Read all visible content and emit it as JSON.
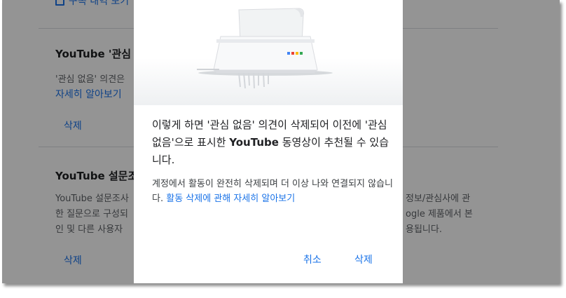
{
  "background": {
    "top_link": "구독 내역 보기",
    "section1": {
      "title": "YouTube '관심 없",
      "desc_start": "'관심 없음' 의견은",
      "learn_more": "자세히 알아보기",
      "delete": "삭제"
    },
    "section2": {
      "title": "YouTube 설문조",
      "line1_left": "YouTube 설문조사",
      "line1_right": "정보/관심사에 관",
      "line2_left": "한 질문으로 구성되",
      "line2_right": "ogle 제품에서 본",
      "line3_left": "인 및 다른 사용자",
      "line3_right": "용됩니다.",
      "delete": "삭제"
    }
  },
  "dialog": {
    "message1_a": "이렇게 하면 '관심 없음' 의견이 삭제되어 이전에 '관심 없음'으로 표시한 ",
    "message1_brand": "YouTube",
    "message1_b": " 동영상이 추천될 수 있습니다.",
    "message2_text": "계정에서 활동이 완전히 삭제되며 더 이상 나와 연결되지 않습니다. ",
    "message2_link": "활동 삭제에 관해 자세히 알아보기",
    "cancel_label": "취소",
    "delete_label": "삭제"
  },
  "colors": {
    "accent": "#1a73e8",
    "scrim": "rgba(0,0,0,0.42)",
    "logo_dots": [
      "#4285f4",
      "#ea4335",
      "#fbbc04",
      "#34a853"
    ]
  }
}
